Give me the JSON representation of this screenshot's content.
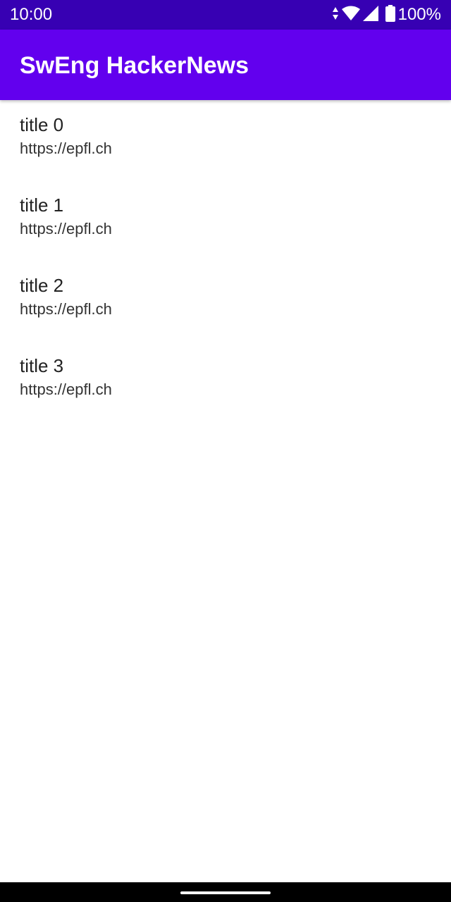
{
  "status_bar": {
    "time": "10:00",
    "battery_label": "100%",
    "icons": [
      "data-arrows-icon",
      "wifi-icon",
      "cell-signal-icon",
      "battery-icon"
    ]
  },
  "app_bar": {
    "title": "SwEng HackerNews",
    "color": "#6200EE"
  },
  "status_bar_color": "#3700B3",
  "items": [
    {
      "title": "title 0",
      "url": "https://epfl.ch"
    },
    {
      "title": "title 1",
      "url": "https://epfl.ch"
    },
    {
      "title": "title 2",
      "url": "https://epfl.ch"
    },
    {
      "title": "title 3",
      "url": "https://epfl.ch"
    }
  ]
}
